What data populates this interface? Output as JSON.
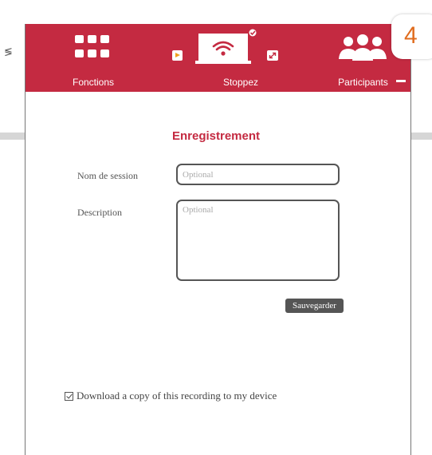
{
  "colors": {
    "brand": "#c42a41",
    "badge_text": "#e06c1e",
    "save_button": "#555555"
  },
  "side_logo": "≶",
  "toolbar": {
    "fonctions_label": "Fonctions",
    "stoppez_label": "Stoppez",
    "participants_label": "Participants",
    "icons": [
      "grid-icon",
      "play-icon",
      "screen-share-wifi-icon",
      "expand-icon",
      "participants-icon",
      "minimize-icon"
    ]
  },
  "badge": "4",
  "form": {
    "title": "Enregistrement",
    "session_label": "Nom de session",
    "session_placeholder": "Optional",
    "session_value": "",
    "description_label": "Description",
    "description_placeholder": "Optional",
    "description_value": "",
    "save_label": "Sauvegarder"
  },
  "download": {
    "checked": true,
    "label": "Download a copy of this recording to my device"
  }
}
